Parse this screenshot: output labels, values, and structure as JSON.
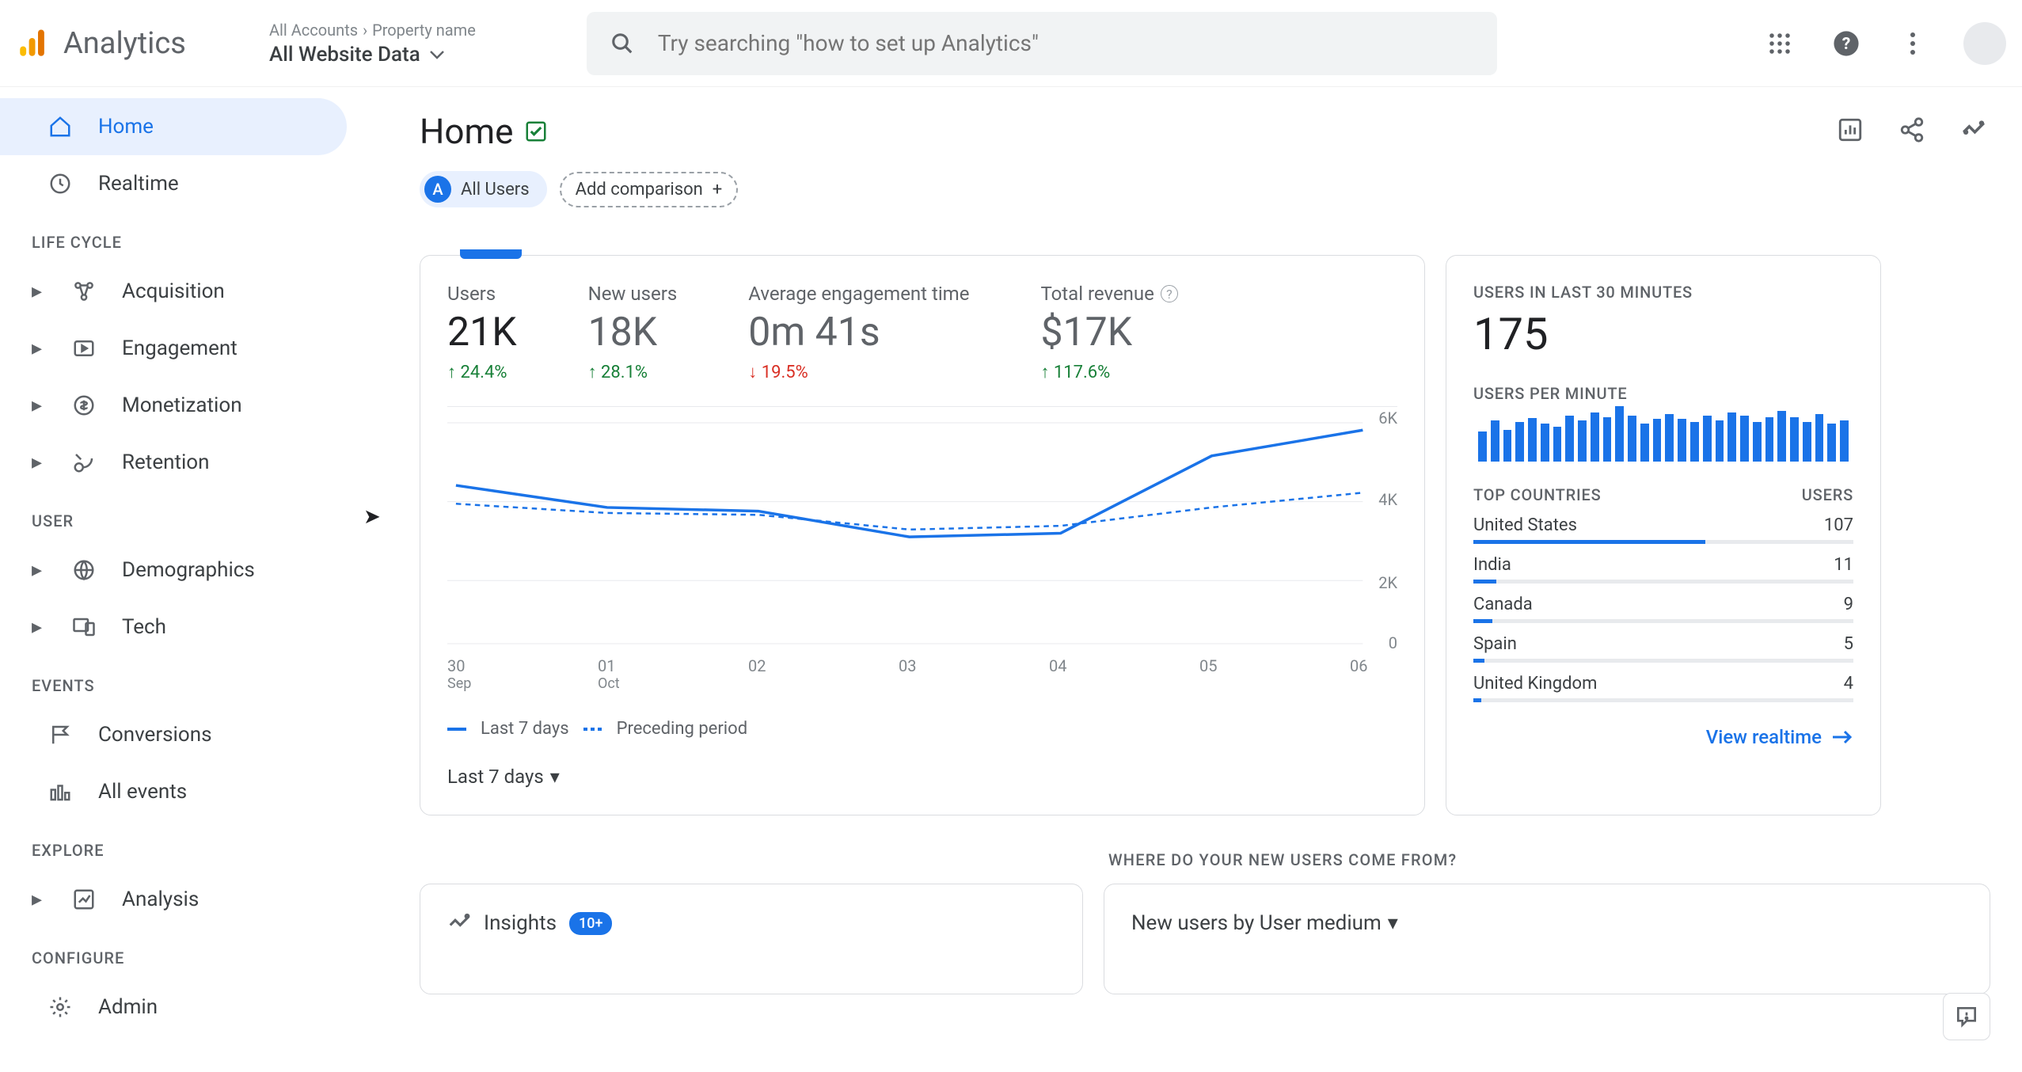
{
  "header": {
    "app_name": "Analytics",
    "breadcrumb_all": "All Accounts",
    "breadcrumb_prop": "Property name",
    "selector_label": "All Website Data",
    "search_placeholder": "Try searching \"how to set up Analytics\""
  },
  "sidebar": {
    "home": "Home",
    "realtime": "Realtime",
    "sec_lifecycle": "LIFE CYCLE",
    "acquisition": "Acquisition",
    "engagement": "Engagement",
    "monetization": "Monetization",
    "retention": "Retention",
    "sec_user": "USER",
    "demographics": "Demographics",
    "tech": "Tech",
    "sec_events": "EVENTS",
    "conversions": "Conversions",
    "all_events": "All events",
    "sec_explore": "EXPLORE",
    "analysis": "Analysis",
    "sec_configure": "CONFIGURE",
    "admin": "Admin"
  },
  "page": {
    "title": "Home",
    "chip_badge": "A",
    "chip_all": "All Users",
    "chip_add": "Add comparison"
  },
  "metrics": [
    {
      "label": "Users",
      "value": "21K",
      "delta": "24.4%",
      "dir": "up"
    },
    {
      "label": "New users",
      "value": "18K",
      "delta": "28.1%",
      "dir": "up"
    },
    {
      "label": "Average engagement time",
      "value": "0m 41s",
      "delta": "19.5%",
      "dir": "down"
    },
    {
      "label": "Total revenue",
      "value": "$17K",
      "delta": "117.6%",
      "dir": "up",
      "help": true
    }
  ],
  "chart_data": {
    "type": "line",
    "categories": [
      "30",
      "01",
      "02",
      "03",
      "04",
      "05",
      "06"
    ],
    "cat_sub": [
      "Sep",
      "Oct",
      "",
      "",
      "",
      "",
      ""
    ],
    "series": [
      {
        "name": "Last 7 days",
        "values": [
          4300,
          3700,
          3600,
          2900,
          3000,
          5100,
          5800
        ],
        "style": "solid"
      },
      {
        "name": "Preceding period",
        "values": [
          3800,
          3550,
          3500,
          3100,
          3200,
          3700,
          4100
        ],
        "style": "dashed"
      }
    ],
    "ylim": [
      0,
      6000
    ],
    "yticks": [
      0,
      2000,
      4000,
      6000
    ],
    "ytick_labels": [
      "0",
      "2K",
      "4K",
      "6K"
    ]
  },
  "legend": {
    "current": "Last 7 days",
    "prev": "Preceding period"
  },
  "date_dropdown": "Last 7 days",
  "realtime": {
    "heading": "USERS IN LAST 30 MINUTES",
    "value": "175",
    "per_min": "USERS PER MINUTE",
    "bars": [
      38,
      52,
      40,
      50,
      55,
      48,
      44,
      58,
      52,
      62,
      56,
      70,
      58,
      48,
      54,
      60,
      54,
      50,
      58,
      52,
      62,
      58,
      50,
      56,
      64,
      56,
      50,
      60,
      48,
      52
    ],
    "col_country": "TOP COUNTRIES",
    "col_users": "USERS",
    "countries": [
      {
        "name": "United States",
        "users": 107,
        "pct": 61
      },
      {
        "name": "India",
        "users": 11,
        "pct": 6
      },
      {
        "name": "Canada",
        "users": 9,
        "pct": 5
      },
      {
        "name": "Spain",
        "users": 5,
        "pct": 3
      },
      {
        "name": "United Kingdom",
        "users": 4,
        "pct": 2
      }
    ],
    "view": "View realtime"
  },
  "bottom": {
    "section": "WHERE DO YOUR NEW USERS COME FROM?",
    "insights": "Insights",
    "insights_badge": "10+",
    "medium_dropdown": "New users by User medium"
  }
}
